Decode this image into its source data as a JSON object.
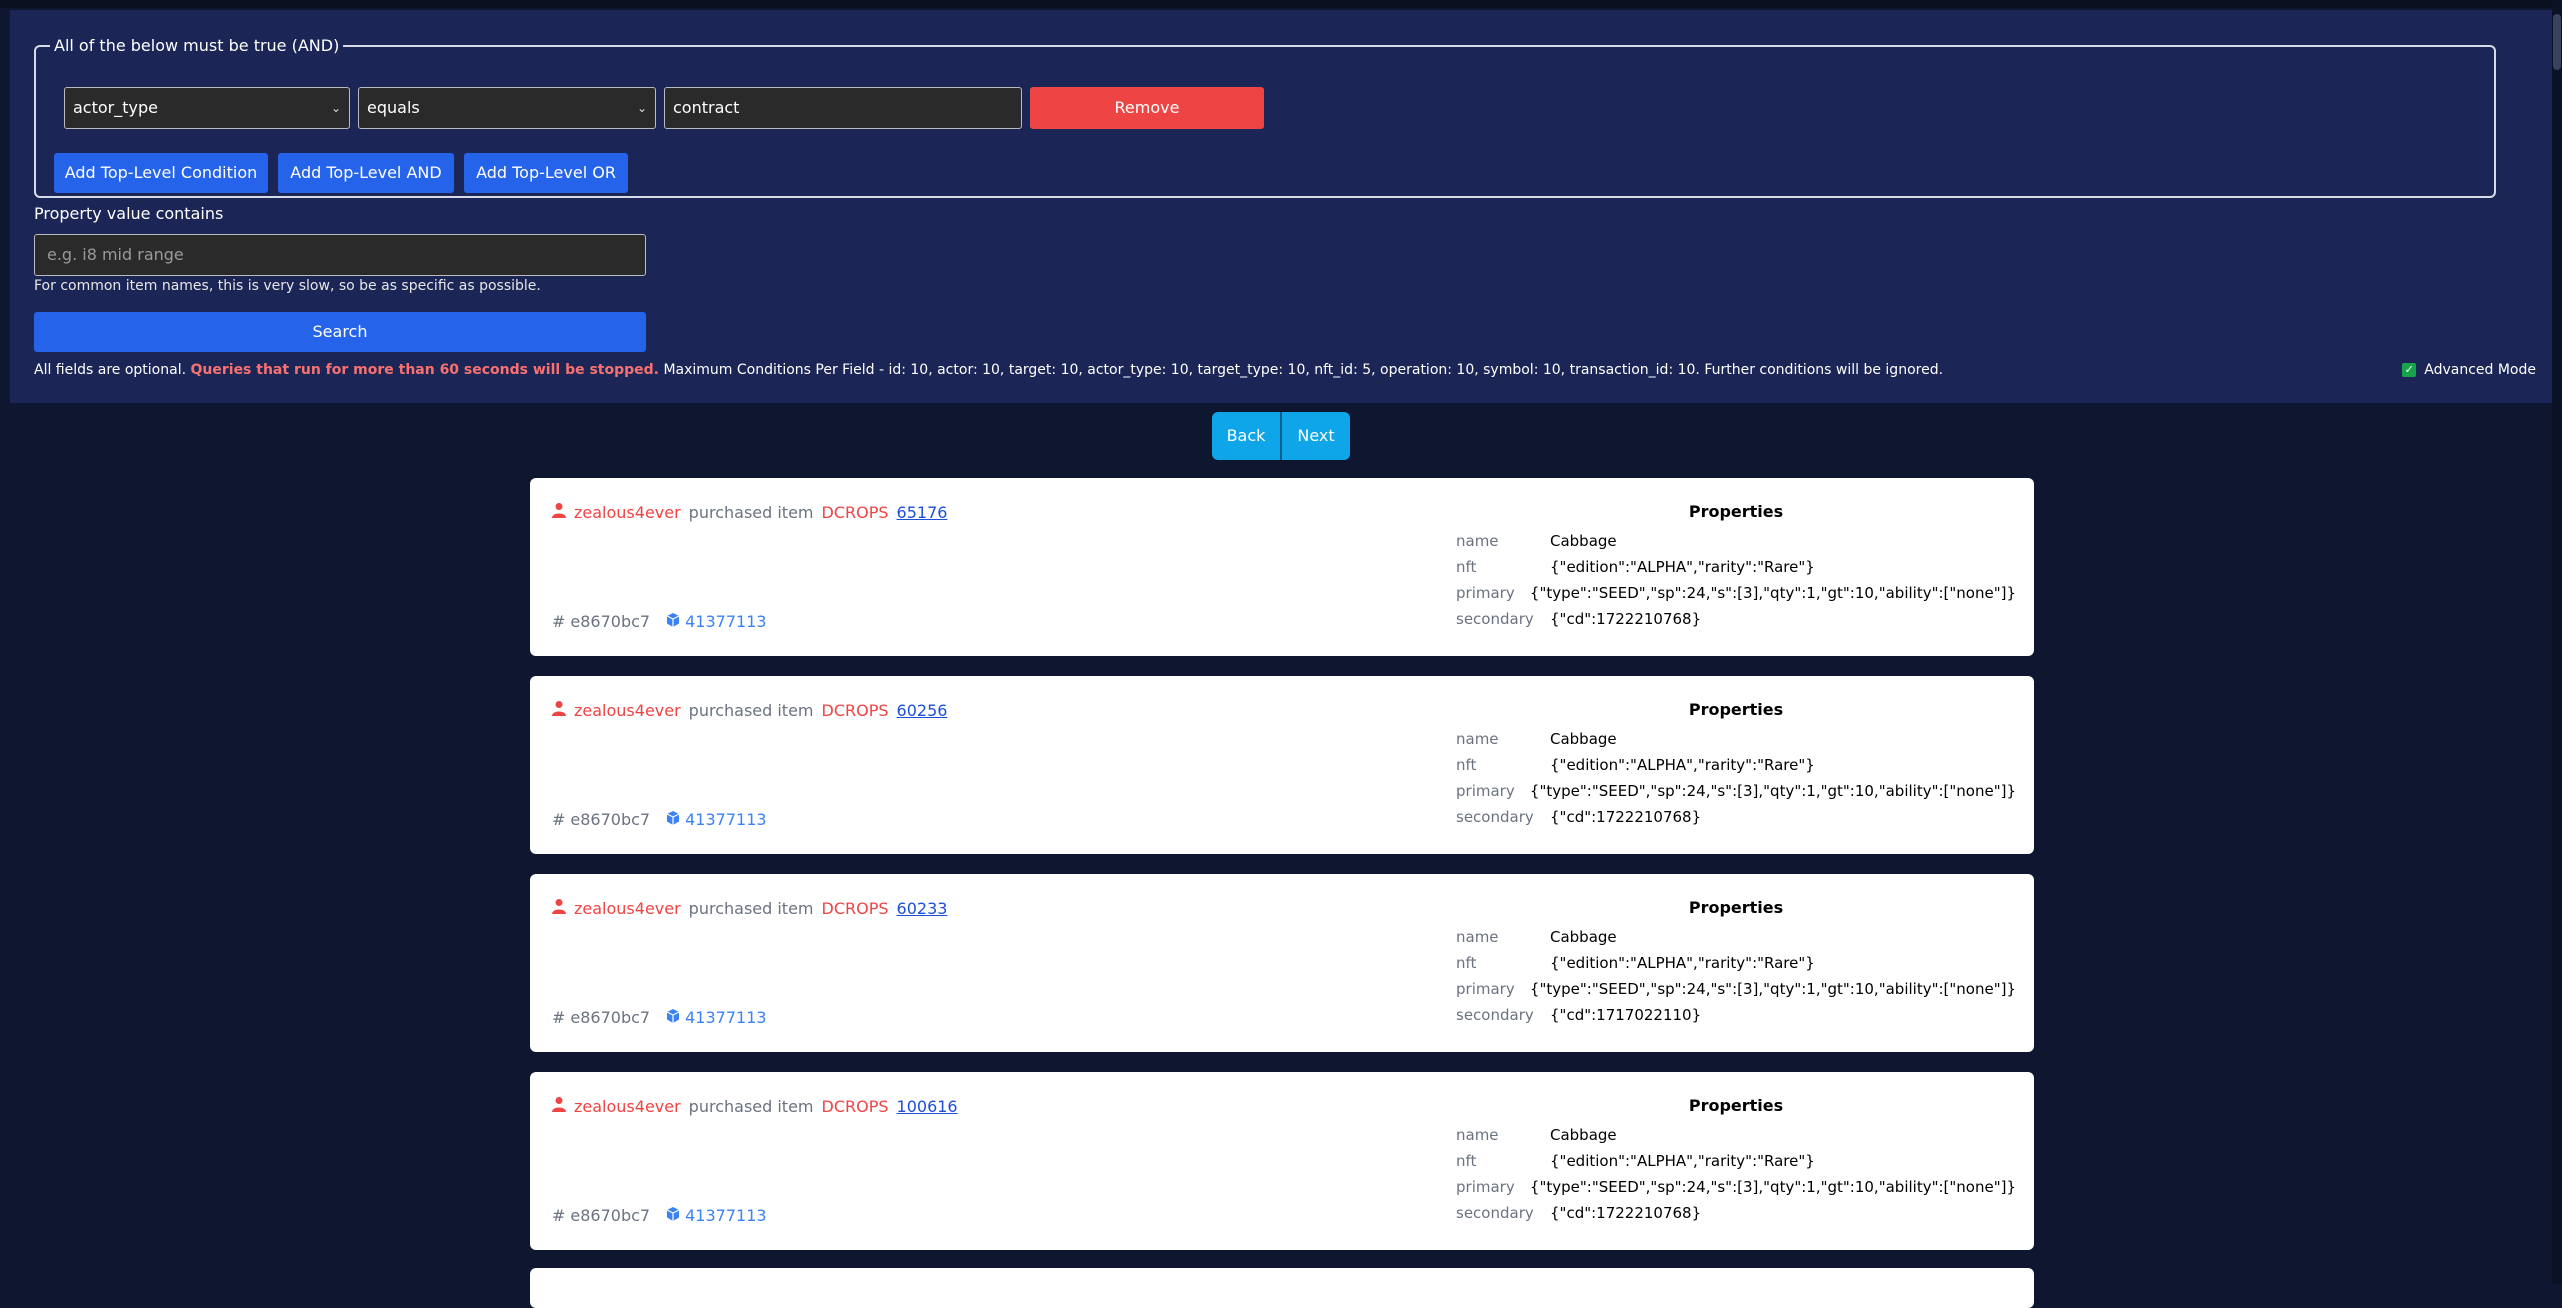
{
  "filter": {
    "group_legend": "All of the below must be true (AND)",
    "condition": {
      "field_value": "actor_type",
      "operator_value": "equals",
      "value": "contract",
      "remove_label": "Remove"
    },
    "add_condition_label": "Add Top-Level Condition",
    "add_and_label": "Add Top-Level AND",
    "add_or_label": "Add Top-Level OR",
    "property_label": "Property value contains",
    "property_placeholder": "e.g. i8 mid range",
    "property_helper": "For common item names, this is very slow, so be as specific as possible.",
    "search_label": "Search",
    "notice_prefix": "All fields are optional.",
    "notice_warning": "Queries that run for more than 60 seconds will be stopped.",
    "notice_suffix": "Maximum Conditions Per Field - id: 10, actor: 10, target: 10, actor_type: 10, target_type: 10, nft_id: 5, operation: 10, symbol: 10, transaction_id: 10. Further conditions will be ignored.",
    "advanced_mode_label": "Advanced Mode"
  },
  "pager": {
    "back_label": "Back",
    "next_label": "Next"
  },
  "results": [
    {
      "actor": "zealous4ever",
      "action": "purchased item",
      "symbol": "DCROPS",
      "item_id": "65176",
      "tx_hash": "e8670bc7",
      "block": "41377113",
      "properties_title": "Properties",
      "properties": [
        {
          "key": "name",
          "value": "Cabbage"
        },
        {
          "key": "nft",
          "value": "{\"edition\":\"ALPHA\",\"rarity\":\"Rare\"}"
        },
        {
          "key": "primary",
          "value": "{\"type\":\"SEED\",\"sp\":24,\"s\":[3],\"qty\":1,\"gt\":10,\"ability\":[\"none\"]}"
        },
        {
          "key": "secondary",
          "value": "{\"cd\":1722210768}"
        }
      ]
    },
    {
      "actor": "zealous4ever",
      "action": "purchased item",
      "symbol": "DCROPS",
      "item_id": "60256",
      "tx_hash": "e8670bc7",
      "block": "41377113",
      "properties_title": "Properties",
      "properties": [
        {
          "key": "name",
          "value": "Cabbage"
        },
        {
          "key": "nft",
          "value": "{\"edition\":\"ALPHA\",\"rarity\":\"Rare\"}"
        },
        {
          "key": "primary",
          "value": "{\"type\":\"SEED\",\"sp\":24,\"s\":[3],\"qty\":1,\"gt\":10,\"ability\":[\"none\"]}"
        },
        {
          "key": "secondary",
          "value": "{\"cd\":1722210768}"
        }
      ]
    },
    {
      "actor": "zealous4ever",
      "action": "purchased item",
      "symbol": "DCROPS",
      "item_id": "60233",
      "tx_hash": "e8670bc7",
      "block": "41377113",
      "properties_title": "Properties",
      "properties": [
        {
          "key": "name",
          "value": "Cabbage"
        },
        {
          "key": "nft",
          "value": "{\"edition\":\"ALPHA\",\"rarity\":\"Rare\"}"
        },
        {
          "key": "primary",
          "value": "{\"type\":\"SEED\",\"sp\":24,\"s\":[3],\"qty\":1,\"gt\":10,\"ability\":[\"none\"]}"
        },
        {
          "key": "secondary",
          "value": "{\"cd\":1717022110}"
        }
      ]
    },
    {
      "actor": "zealous4ever",
      "action": "purchased item",
      "symbol": "DCROPS",
      "item_id": "100616",
      "tx_hash": "e8670bc7",
      "block": "41377113",
      "properties_title": "Properties",
      "properties": [
        {
          "key": "name",
          "value": "Cabbage"
        },
        {
          "key": "nft",
          "value": "{\"edition\":\"ALPHA\",\"rarity\":\"Rare\"}"
        },
        {
          "key": "primary",
          "value": "{\"type\":\"SEED\",\"sp\":24,\"s\":[3],\"qty\":1,\"gt\":10,\"ability\":[\"none\"]}"
        },
        {
          "key": "secondary",
          "value": "{\"cd\":1722210768}"
        }
      ]
    }
  ]
}
